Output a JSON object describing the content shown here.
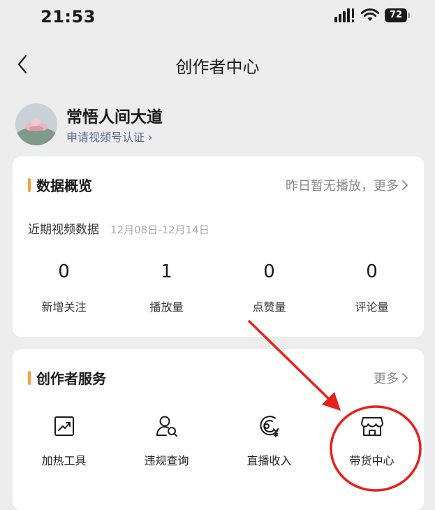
{
  "status_bar": {
    "time": "21:53",
    "battery": "72"
  },
  "nav": {
    "title": "创作者中心"
  },
  "profile": {
    "name": "常悟人间大道",
    "verify_link": "申请视频号认证 ›"
  },
  "data_overview": {
    "title": "数据概览",
    "more": "昨日暂无播放，更多",
    "period_label": "近期视频数据",
    "period_range": "12月08日-12月14日",
    "stats": [
      {
        "value": "0",
        "label": "新增关注"
      },
      {
        "value": "1",
        "label": "播放量"
      },
      {
        "value": "0",
        "label": "点赞量"
      },
      {
        "value": "0",
        "label": "评论量"
      }
    ]
  },
  "creator_services": {
    "title": "创作者服务",
    "more": "更多",
    "items": [
      {
        "label": "加热工具",
        "icon": "trending-up-icon"
      },
      {
        "label": "违规查询",
        "icon": "user-search-icon"
      },
      {
        "label": "直播收入",
        "icon": "live-income-icon"
      },
      {
        "label": "带货中心",
        "icon": "store-icon"
      }
    ]
  },
  "annotation": {
    "color": "#E8201C",
    "highlighted_item": "带货中心"
  }
}
